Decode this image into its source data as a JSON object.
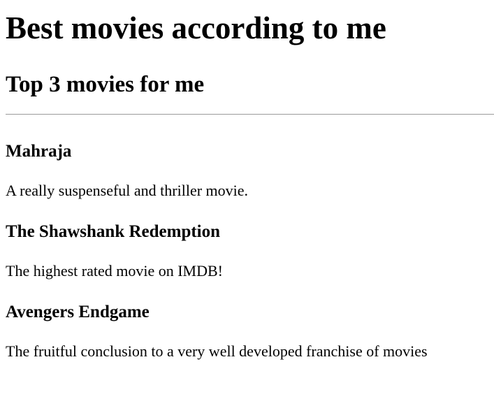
{
  "page": {
    "heading": "Best movies according to me",
    "subheading": "Top 3 movies for me"
  },
  "movies": [
    {
      "title": "Mahraja",
      "description": "A really suspenseful and thriller movie."
    },
    {
      "title": "The Shawshank Redemption",
      "description": "The highest rated movie on IMDB!"
    },
    {
      "title": "Avengers Endgame",
      "description": "The fruitful conclusion to a very well developed franchise of movies"
    }
  ]
}
